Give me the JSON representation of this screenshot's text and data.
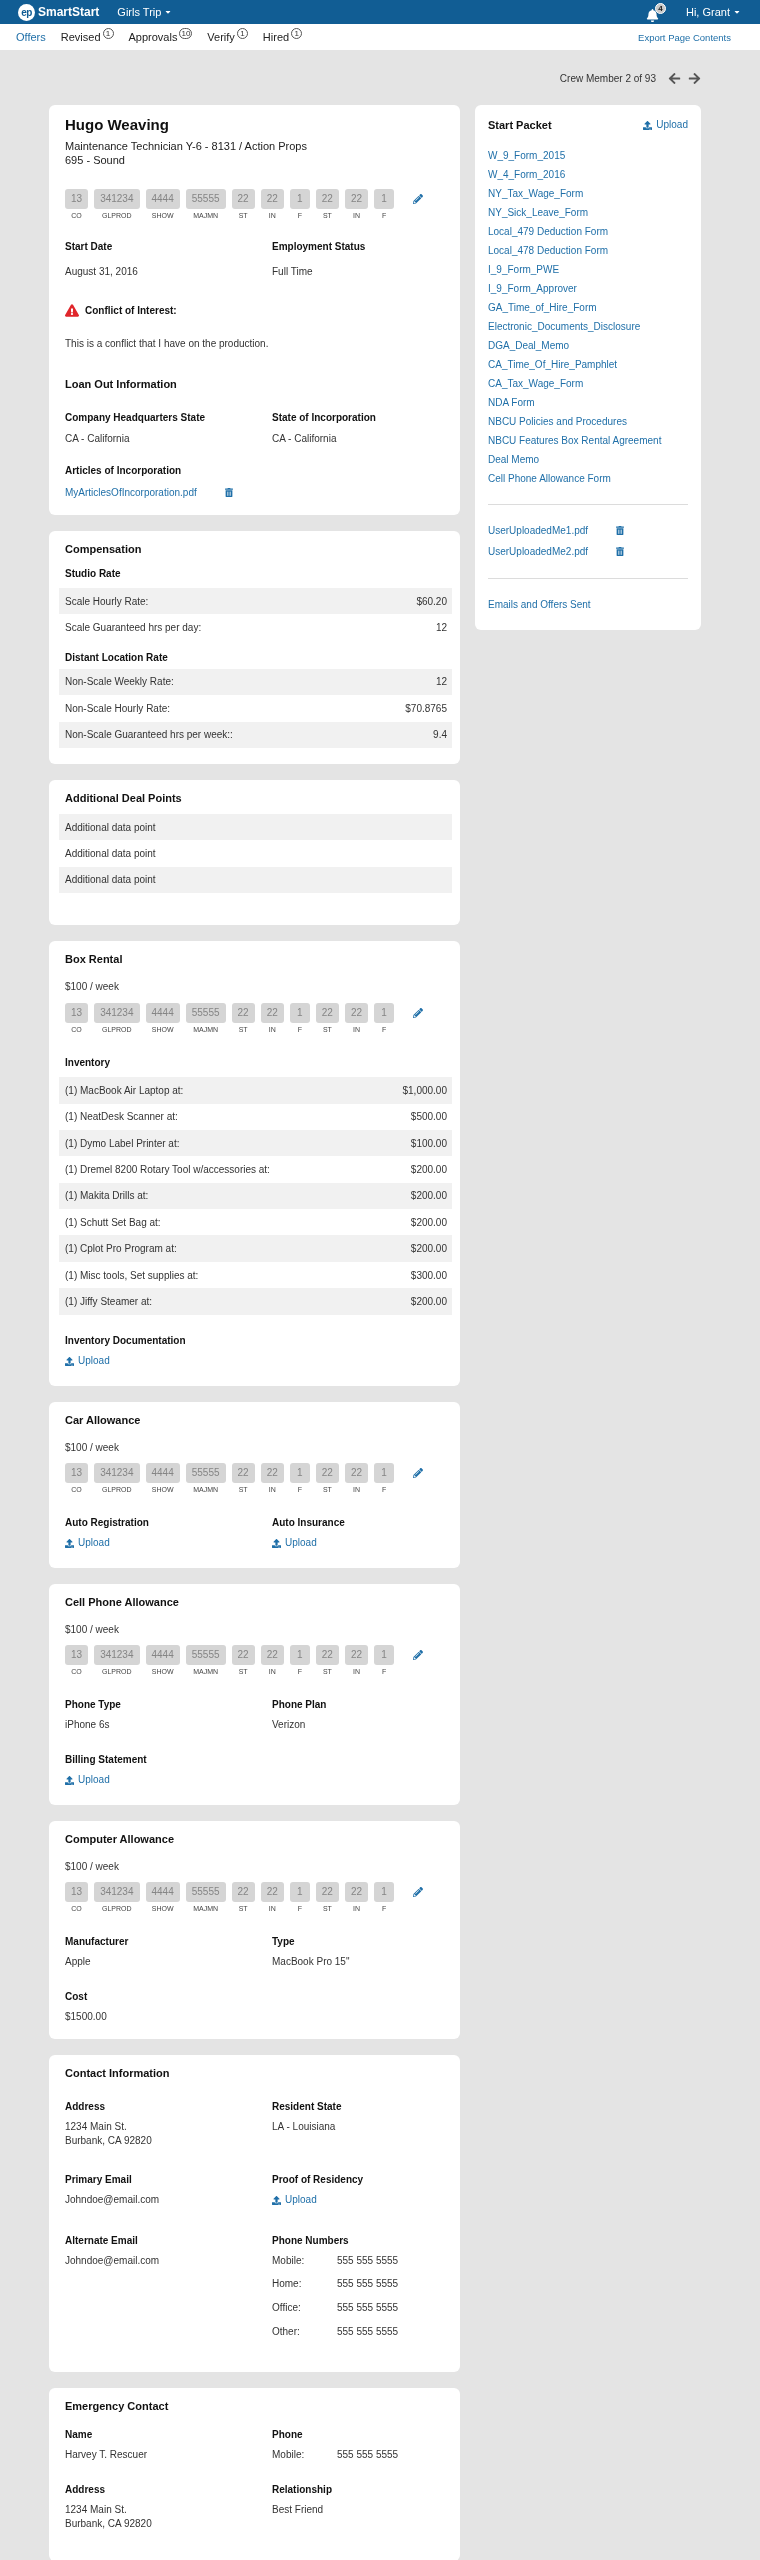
{
  "header": {
    "logo_mark": "ep",
    "app_name": "SmartStart",
    "project": "Girls Trip",
    "notification_count": "4",
    "greeting": "Hi, Grant"
  },
  "nav": {
    "tabs": [
      {
        "label": "Offers",
        "selected": true
      },
      {
        "label": "Revised",
        "count": "1",
        "selected": false
      },
      {
        "label": "Approvals",
        "count": "10",
        "selected": false
      },
      {
        "label": "Verify",
        "count": "1",
        "selected": false
      },
      {
        "label": "Hired",
        "count": "1",
        "selected": false
      }
    ],
    "export_link": "Export Page Contents"
  },
  "pager": {
    "label": "Crew Member 2 of 93"
  },
  "offer": {
    "name": "Hugo Weaving",
    "position": "Maintenance Technician Y-6 - 8131 / Action Props",
    "department": "695 - Sound",
    "account_codes": [
      {
        "value": "13",
        "label": "CO"
      },
      {
        "value": "341234",
        "label": "GLPROD"
      },
      {
        "value": "4444",
        "label": "SHOW"
      },
      {
        "value": "55555",
        "label": "MAJMN"
      },
      {
        "value": "22",
        "label": "ST"
      },
      {
        "value": "22",
        "label": "IN"
      },
      {
        "value": "1",
        "label": "F"
      },
      {
        "value": "22",
        "label": "ST"
      },
      {
        "value": "22",
        "label": "IN"
      },
      {
        "value": "1",
        "label": "F"
      }
    ],
    "fields": [
      {
        "label": "Start Date",
        "value": "August 31, 2016"
      },
      {
        "label": "Employment Status",
        "value": "Full Time"
      }
    ],
    "conflict": {
      "title": "Conflict of Interest:",
      "text": "This is a conflict that I have on the production."
    },
    "loan_out": {
      "title": "Loan Out Information",
      "fields": [
        {
          "label": "Company Headquarters State",
          "value": "CA - California"
        },
        {
          "label": "State of Incorporation",
          "value": "CA - California"
        }
      ],
      "articles": {
        "label": "Articles of Incorporation",
        "file": "MyArticlesOfIncorporation.pdf"
      }
    }
  },
  "compensation": {
    "title": "Compensation",
    "groups": [
      {
        "title": "Studio Rate",
        "rows": [
          {
            "label": "Scale Hourly Rate:",
            "value": "$60.20"
          },
          {
            "label": "Scale Guaranteed hrs per day:",
            "value": "12"
          }
        ]
      },
      {
        "title": "Distant Location Rate",
        "rows": [
          {
            "label": "Non-Scale Weekly Rate:",
            "value": "12"
          },
          {
            "label": "Non-Scale Hourly Rate:",
            "value": "$70.8765"
          },
          {
            "label": "Non-Scale Guaranteed hrs per week::",
            "value": "9.4"
          }
        ]
      }
    ]
  },
  "additional_deal_points": {
    "title": "Additional Deal Points",
    "rows": [
      "Additional data point",
      "Additional data point",
      "Additional data point"
    ]
  },
  "box_rental": {
    "title": "Box Rental",
    "rate": "$100 / week",
    "account_codes": [
      {
        "value": "13",
        "label": "CO"
      },
      {
        "value": "341234",
        "label": "GLPROD"
      },
      {
        "value": "4444",
        "label": "SHOW"
      },
      {
        "value": "55555",
        "label": "MAJMN"
      },
      {
        "value": "22",
        "label": "ST"
      },
      {
        "value": "22",
        "label": "IN"
      },
      {
        "value": "1",
        "label": "F"
      },
      {
        "value": "22",
        "label": "ST"
      },
      {
        "value": "22",
        "label": "IN"
      },
      {
        "value": "1",
        "label": "F"
      }
    ],
    "inventory": {
      "title": "Inventory",
      "rows": [
        {
          "label": "(1) MacBook Air Laptop at:",
          "value": "$1,000.00"
        },
        {
          "label": "(1) NeatDesk Scanner at:",
          "value": "$500.00"
        },
        {
          "label": "(1) Dymo Label Printer at:",
          "value": "$100.00"
        },
        {
          "label": "(1) Dremel 8200 Rotary Tool w/accessories at:",
          "value": "$200.00"
        },
        {
          "label": "(1) Makita Drills at:",
          "value": "$200.00"
        },
        {
          "label": "(1) Schutt Set Bag at:",
          "value": "$200.00"
        },
        {
          "label": "(1) Cplot Pro Program at:",
          "value": "$200.00"
        },
        {
          "label": "(1) Misc tools, Set supplies at:",
          "value": "$300.00"
        },
        {
          "label": "(1) Jiffy Steamer at:",
          "value": "$200.00"
        }
      ]
    },
    "documentation": {
      "label": "Inventory Documentation",
      "action": "Upload"
    }
  },
  "allowances": [
    {
      "title": "Car Allowance",
      "rate": "$100 / week",
      "account_codes": [
        {
          "value": "13",
          "label": "CO"
        },
        {
          "value": "341234",
          "label": "GLPROD"
        },
        {
          "value": "4444",
          "label": "SHOW"
        },
        {
          "value": "55555",
          "label": "MAJMN"
        },
        {
          "value": "22",
          "label": "ST"
        },
        {
          "value": "22",
          "label": "IN"
        },
        {
          "value": "1",
          "label": "F"
        },
        {
          "value": "22",
          "label": "ST"
        },
        {
          "value": "22",
          "label": "IN"
        },
        {
          "value": "1",
          "label": "F"
        }
      ],
      "fields": [
        {
          "kind": "upload",
          "label": "Auto Registration",
          "action": "Upload"
        },
        {
          "kind": "upload",
          "label": "Auto Insurance",
          "action": "Upload"
        }
      ]
    },
    {
      "title": "Cell Phone Allowance",
      "rate": "$100 / week",
      "account_codes": [
        {
          "value": "13",
          "label": "CO"
        },
        {
          "value": "341234",
          "label": "GLPROD"
        },
        {
          "value": "4444",
          "label": "SHOW"
        },
        {
          "value": "55555",
          "label": "MAJMN"
        },
        {
          "value": "22",
          "label": "ST"
        },
        {
          "value": "22",
          "label": "IN"
        },
        {
          "value": "1",
          "label": "F"
        },
        {
          "value": "22",
          "label": "ST"
        },
        {
          "value": "22",
          "label": "IN"
        },
        {
          "value": "1",
          "label": "F"
        }
      ],
      "fields": [
        {
          "kind": "text",
          "label": "Phone Type",
          "value": "iPhone 6s"
        },
        {
          "kind": "text",
          "label": "Phone Plan",
          "value": "Verizon"
        },
        {
          "kind": "upload",
          "label": "Billing Statement",
          "action": "Upload"
        }
      ]
    },
    {
      "title": "Computer Allowance",
      "rate": "$100 / week",
      "account_codes": [
        {
          "value": "13",
          "label": "CO"
        },
        {
          "value": "341234",
          "label": "GLPROD"
        },
        {
          "value": "4444",
          "label": "SHOW"
        },
        {
          "value": "55555",
          "label": "MAJMN"
        },
        {
          "value": "22",
          "label": "ST"
        },
        {
          "value": "22",
          "label": "IN"
        },
        {
          "value": "1",
          "label": "F"
        },
        {
          "value": "22",
          "label": "ST"
        },
        {
          "value": "22",
          "label": "IN"
        },
        {
          "value": "1",
          "label": "F"
        }
      ],
      "fields": [
        {
          "kind": "text",
          "label": "Manufacturer",
          "value": "Apple"
        },
        {
          "kind": "text",
          "label": "Type",
          "value": "MacBook Pro 15\""
        },
        {
          "kind": "text",
          "label": "Cost",
          "value": "$1500.00"
        }
      ]
    }
  ],
  "contact_information": {
    "title": "Contact Information",
    "fields": [
      {
        "kind": "lines",
        "label": "Address",
        "lines": [
          "1234 Main St.",
          "Burbank, CA 92820"
        ]
      },
      {
        "kind": "text",
        "label": "Resident State",
        "value": "LA - Louisiana"
      },
      {
        "kind": "text",
        "label": "Primary Email",
        "value": "Johndoe@email.com"
      },
      {
        "kind": "upload",
        "label": "Proof of Residency",
        "action": "Upload"
      },
      {
        "kind": "text",
        "label": "Alternate Email",
        "value": "Johndoe@email.com"
      },
      {
        "kind": "phones",
        "label": "Phone Numbers",
        "phones": [
          {
            "type": "Mobile:",
            "number": "555 555 5555"
          },
          {
            "type": "Home:",
            "number": "555 555 5555"
          },
          {
            "type": "Office:",
            "number": "555 555 5555"
          },
          {
            "type": "Other:",
            "number": "555 555 5555"
          }
        ]
      }
    ]
  },
  "emergency_contact": {
    "title": "Emergency Contact",
    "fields": [
      {
        "kind": "text",
        "label": "Name",
        "value": "Harvey T. Rescuer"
      },
      {
        "kind": "phones",
        "label": "Phone",
        "phones": [
          {
            "type": "Mobile:",
            "number": "555 555 5555"
          }
        ]
      },
      {
        "kind": "lines",
        "label": "Address",
        "lines": [
          "1234 Main St.",
          "Burbank, CA 92820"
        ]
      },
      {
        "kind": "text",
        "label": "Relationship",
        "value": "Best Friend"
      }
    ]
  },
  "start_packet": {
    "title": "Start Packet",
    "upload_action": "Upload",
    "documents": [
      "W_9_Form_2015",
      "W_4_Form_2016",
      "NY_Tax_Wage_Form",
      "NY_Sick_Leave_Form",
      "Local_479 Deduction Form",
      "Local_478 Deduction Form",
      "I_9_Form_PWE",
      "I_9_Form_Approver",
      "GA_Time_of_Hire_Form",
      "Electronic_Documents_Disclosure",
      "DGA_Deal_Memo",
      "CA_Time_Of_Hire_Pamphlet",
      "CA_Tax_Wage_Form",
      "NDA Form",
      "NBCU Policies and Procedures",
      "NBCU Features Box Rental Agreement",
      "Deal Memo",
      "Cell Phone Allowance Form"
    ],
    "uploaded_files": [
      "UserUploadedMe1.pdf",
      "UserUploadedMe2.pdf"
    ],
    "sent_link": "Emails and Offers Sent"
  }
}
